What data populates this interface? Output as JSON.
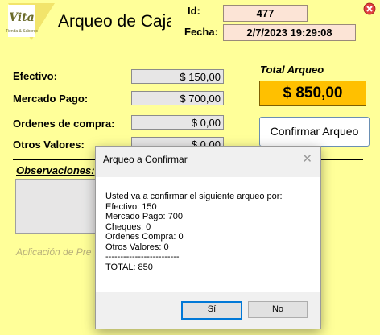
{
  "header": {
    "logo_text": "Vita",
    "logo_sub": "Tienda & Sabores",
    "title": "Arqueo de Caja",
    "id_label": "Id:",
    "id_value": "477",
    "fecha_label": "Fecha:",
    "fecha_value": "2/7/2023 19:29:08",
    "close_icon": "close-icon"
  },
  "form": {
    "efectivo_label": "Efectivo:",
    "efectivo_value": "$ 150,00",
    "mercado_label": "Mercado Pago:",
    "mercado_value": "$ 700,00",
    "ordenes_label": "Ordenes de compra:",
    "ordenes_value": "$ 0,00",
    "otros_label": "Otros Valores:",
    "otros_value": "$ 0,00",
    "obs_label": "Observaciones:",
    "footer_text": "Aplicación de Pre"
  },
  "total": {
    "label": "Total Arqueo",
    "value": "$ 850,00",
    "confirm_label": "Confirmar Arqueo"
  },
  "dialog": {
    "title": "Arqueo a Confirmar",
    "close_glyph": "✕",
    "message": "Usted va a confirmar el siguiente arqueo por:\nEfectivo: 150\nMercado Pago: 700\nCheques: 0\nOrdenes Compra: 0\nOtros Valores: 0\n-------------------------\nTOTAL: 850",
    "yes_label": "Sí",
    "no_label": "No"
  },
  "colors": {
    "background": "#ffff99",
    "id_box": "#fce4d6",
    "total_box": "#ffc000",
    "close_red": "#e04040"
  }
}
